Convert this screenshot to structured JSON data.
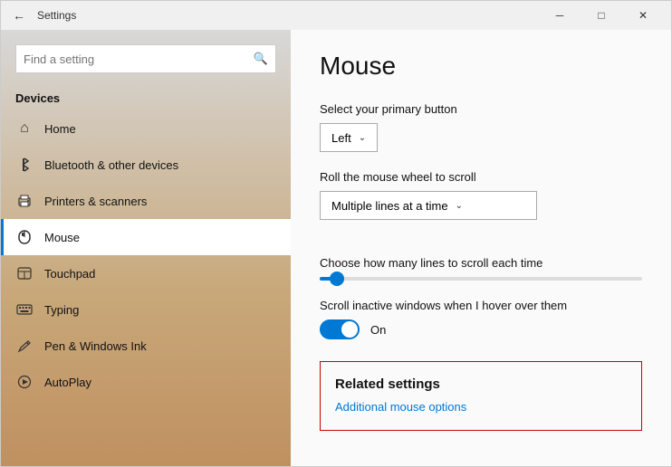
{
  "titleBar": {
    "title": "Settings",
    "minimizeLabel": "─",
    "maximizeLabel": "□",
    "closeLabel": "✕"
  },
  "sidebar": {
    "searchPlaceholder": "Find a setting",
    "sectionLabel": "Devices",
    "items": [
      {
        "id": "home",
        "label": "Home",
        "icon": "⌂",
        "active": false
      },
      {
        "id": "bluetooth",
        "label": "Bluetooth & other devices",
        "icon": "⚇",
        "active": false
      },
      {
        "id": "printers",
        "label": "Printers & scanners",
        "icon": "🖨",
        "active": false
      },
      {
        "id": "mouse",
        "label": "Mouse",
        "icon": "🖱",
        "active": true
      },
      {
        "id": "touchpad",
        "label": "Touchpad",
        "icon": "▭",
        "active": false
      },
      {
        "id": "typing",
        "label": "Typing",
        "icon": "⌨",
        "active": false
      },
      {
        "id": "pen",
        "label": "Pen & Windows Ink",
        "icon": "✏",
        "active": false
      },
      {
        "id": "autoplay",
        "label": "AutoPlay",
        "icon": "⊙",
        "active": false
      }
    ]
  },
  "main": {
    "pageTitle": "Mouse",
    "primaryButtonLabel": "Select your primary button",
    "primaryButtonValue": "Left",
    "scrollWheelLabel": "Roll the mouse wheel to scroll",
    "scrollWheelValue": "Multiple lines at a time",
    "scrollLinesLabel": "Choose how many lines to scroll each time",
    "scrollInactiveLabel": "Scroll inactive windows when I hover over them",
    "toggleState": "On",
    "relatedSettings": {
      "title": "Related settings",
      "linkLabel": "Additional mouse options"
    }
  }
}
